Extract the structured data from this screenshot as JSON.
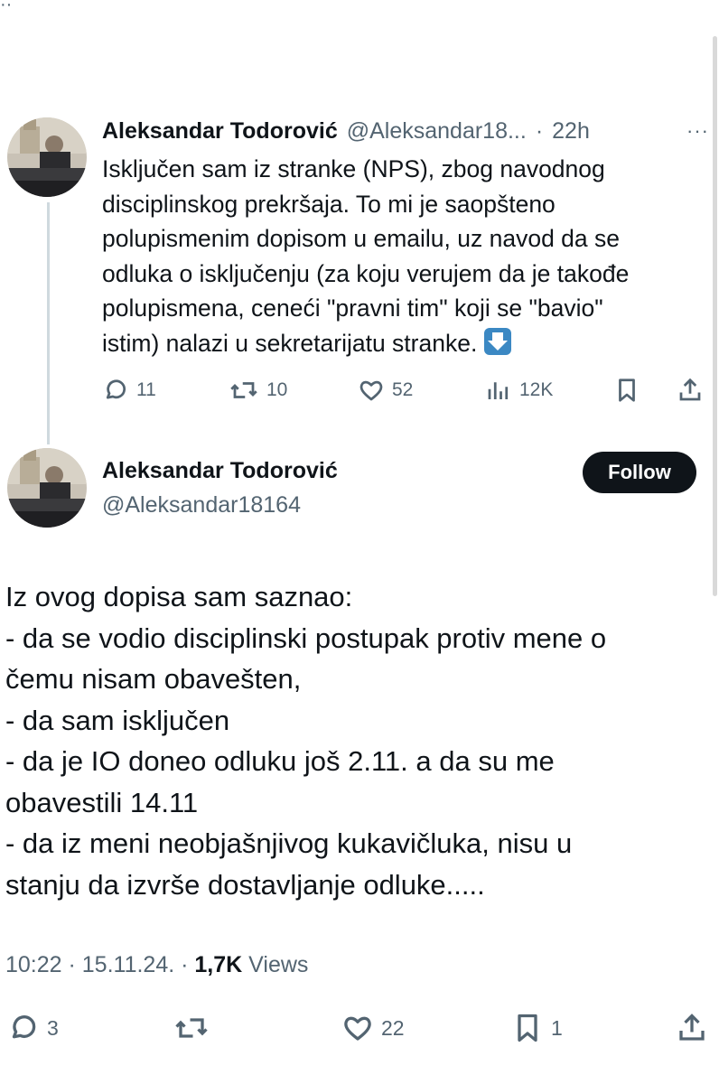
{
  "thread_tweet": {
    "author_name": "Aleksandar Todorović",
    "author_handle": "@Aleksandar18...",
    "separator": "·",
    "time": "22h",
    "more_label": "···",
    "lines": [
      "Isključen sam iz stranke (NPS), zbog navodnog",
      "disciplinskog prekršaja. To mi je saopšteno",
      "polupismenim dopisom u emailu, uz navod da se",
      "odluka o isključenju (za koju verujem da je takođe",
      "polupismena, ceneći \"pravni tim\" koji se \"bavio\"",
      "istim) nalazi u sekretarijatu stranke."
    ],
    "emoji": "down-arrow-emoji",
    "stats": {
      "replies": "11",
      "reposts": "10",
      "likes": "52",
      "views": "12K"
    }
  },
  "main_tweet": {
    "author_name": "Aleksandar Todorović",
    "author_handle": "@Aleksandar18164",
    "follow_label": "Follow",
    "lines": [
      "Iz ovog dopisa sam saznao:",
      "- da se vodio disciplinski postupak protiv mene o",
      "čemu nisam obavešten,",
      "- da sam isključen",
      "- da je IO doneo odluku još 2.11. a da su me",
      "obavestili 14.11",
      "- da iz meni neobjašnjivog kukavičluka, nisu u",
      "stanju da izvrše dostavljanje odluke....."
    ],
    "meta": {
      "time": "10:22",
      "sep1": " · ",
      "date": "15.11.24.",
      "sep2": " · ",
      "views_count": "1,7K",
      "views_label": " Views"
    },
    "stats": {
      "replies": "3",
      "likes": "22",
      "bookmarks": "1"
    }
  },
  "icons": [
    "reply-icon",
    "repost-icon",
    "like-icon",
    "views-icon",
    "bookmark-icon",
    "share-icon"
  ],
  "colors": {
    "text": "#0f1419",
    "secondary": "#536471",
    "thread_line": "#cfd9de",
    "follow_bg": "#0f1419",
    "emoji_blue": "#3b88c3"
  }
}
